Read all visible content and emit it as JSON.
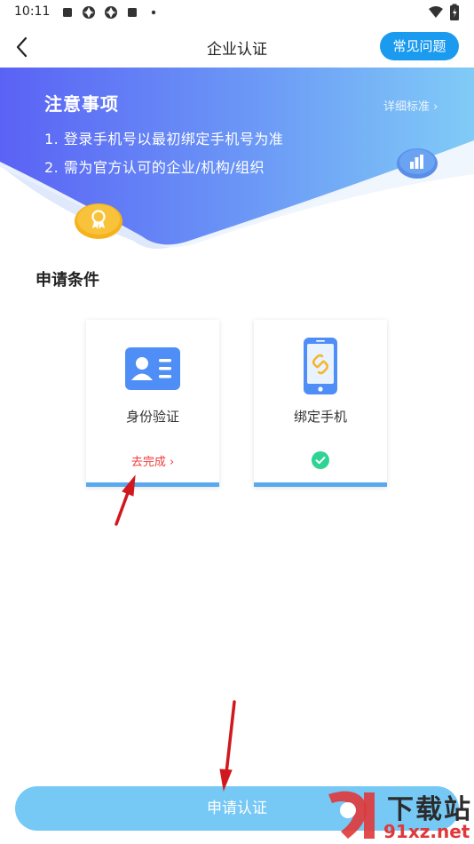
{
  "status_bar": {
    "time": "10:11",
    "icons": [
      "notification-square-icon",
      "aperture-icon",
      "aperture-icon",
      "notification-square-icon",
      "dot-icon",
      "wifi-icon",
      "battery-icon"
    ]
  },
  "header": {
    "title": "企业认证",
    "faq_label": "常见问题"
  },
  "notice": {
    "title": "注意事项",
    "items": [
      "1. 登录手机号以最初绑定手机号为准",
      "2. 需为官方认可的企业/机构/组织"
    ],
    "detail_link": "详细标准 ›"
  },
  "conditions": {
    "title": "申请条件",
    "cards": [
      {
        "label": "身份验证",
        "action": "去完成 ›",
        "icon": "id-card-icon",
        "status": "incomplete"
      },
      {
        "label": "绑定手机",
        "icon": "phone-link-icon",
        "status": "complete"
      }
    ]
  },
  "submit": {
    "label": "申请认证"
  },
  "watermark": {
    "brand": "下载站",
    "domain": "91xz.net"
  },
  "colors": {
    "accent": "#1a9bf0",
    "banner_start": "#5b63f5",
    "banner_end": "#7dc6f7",
    "action_red": "#f23b3b",
    "card_bar": "#5aa9f0",
    "check_green": "#2fd394",
    "submit_bg": "#76c8f5",
    "arrow_red": "#d0181e"
  }
}
